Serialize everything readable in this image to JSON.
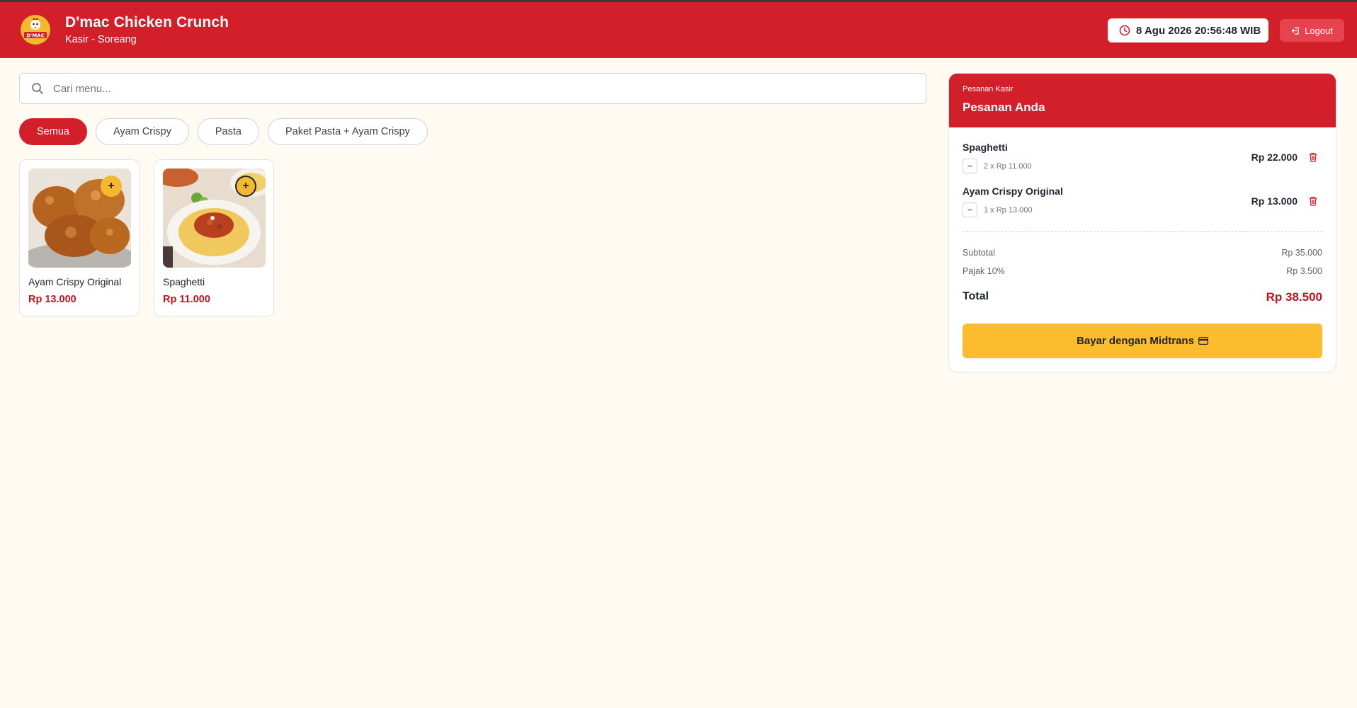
{
  "colors": {
    "brand_red": "#d21f2a",
    "accent_yellow": "#fbbd2e",
    "price_red": "#c0141f",
    "background": "#fffbf3"
  },
  "header": {
    "logo_icon": "dmac-logo-icon",
    "title": "D'mac Chicken Crunch",
    "subtitle": "Kasir - Soreang",
    "datetime": "8 Agu 2026 20:56:48 WIB",
    "logout_label": "Logout"
  },
  "search": {
    "placeholder": "Cari menu...",
    "value": ""
  },
  "filters": [
    {
      "label": "Semua",
      "active": true
    },
    {
      "label": "Ayam Crispy",
      "active": false
    },
    {
      "label": "Pasta",
      "active": false
    },
    {
      "label": "Paket Pasta + Ayam Crispy",
      "active": false
    }
  ],
  "products": [
    {
      "name": "Ayam Crispy Original",
      "price": "Rp 13.000",
      "add_label": "+"
    },
    {
      "name": "Spaghetti",
      "price": "Rp 11.000",
      "add_label": "+"
    }
  ],
  "order": {
    "kicker": "Pesanan Kasir",
    "title": "Pesanan Anda",
    "items": [
      {
        "name": "Spaghetti",
        "qty_text": "2 x Rp 11.000",
        "total": "Rp 22.000",
        "minus_label": "−"
      },
      {
        "name": "Ayam Crispy Original",
        "qty_text": "1 x Rp 13.000",
        "total": "Rp 13.000",
        "minus_label": "−"
      }
    ],
    "subtotal_label": "Subtotal",
    "subtotal_value": "Rp 35.000",
    "tax_label": "Pajak 10%",
    "tax_value": "Rp 3.500",
    "total_label": "Total",
    "total_value": "Rp 38.500",
    "pay_label": "Bayar dengan Midtrans"
  }
}
